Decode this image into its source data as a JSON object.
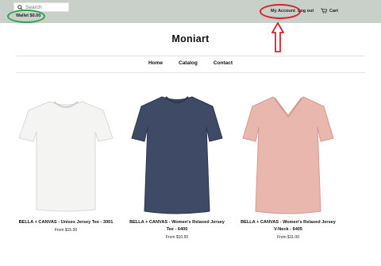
{
  "search": {
    "placeholder": "Search"
  },
  "wallet": {
    "label": "Wallet $0.00"
  },
  "header": {
    "my_account": "My Account",
    "logout": "Log out",
    "cart": "Cart"
  },
  "site": {
    "name": "Moniart"
  },
  "nav": {
    "items": [
      "Home",
      "Catalog",
      "Contact"
    ]
  },
  "products": [
    {
      "title": "BELLA + CANVAS - Unisex Jersey Tee - 3001",
      "price": "From $15.00",
      "color": "#f4f4f2"
    },
    {
      "title": "BELLA + CANVAS - Women's Relaxed Jersey Tee - 6400",
      "price": "From $10.50",
      "color": "#3e4a66"
    },
    {
      "title": "BELLA + CANVAS - Women's Relaxed Jersey V-Neck - 6405",
      "price": "From $11.00",
      "color": "#e9b7ae"
    }
  ],
  "annotations": {
    "wallet_circle_color": "#27a84a",
    "account_circle_color": "#d9232b"
  }
}
